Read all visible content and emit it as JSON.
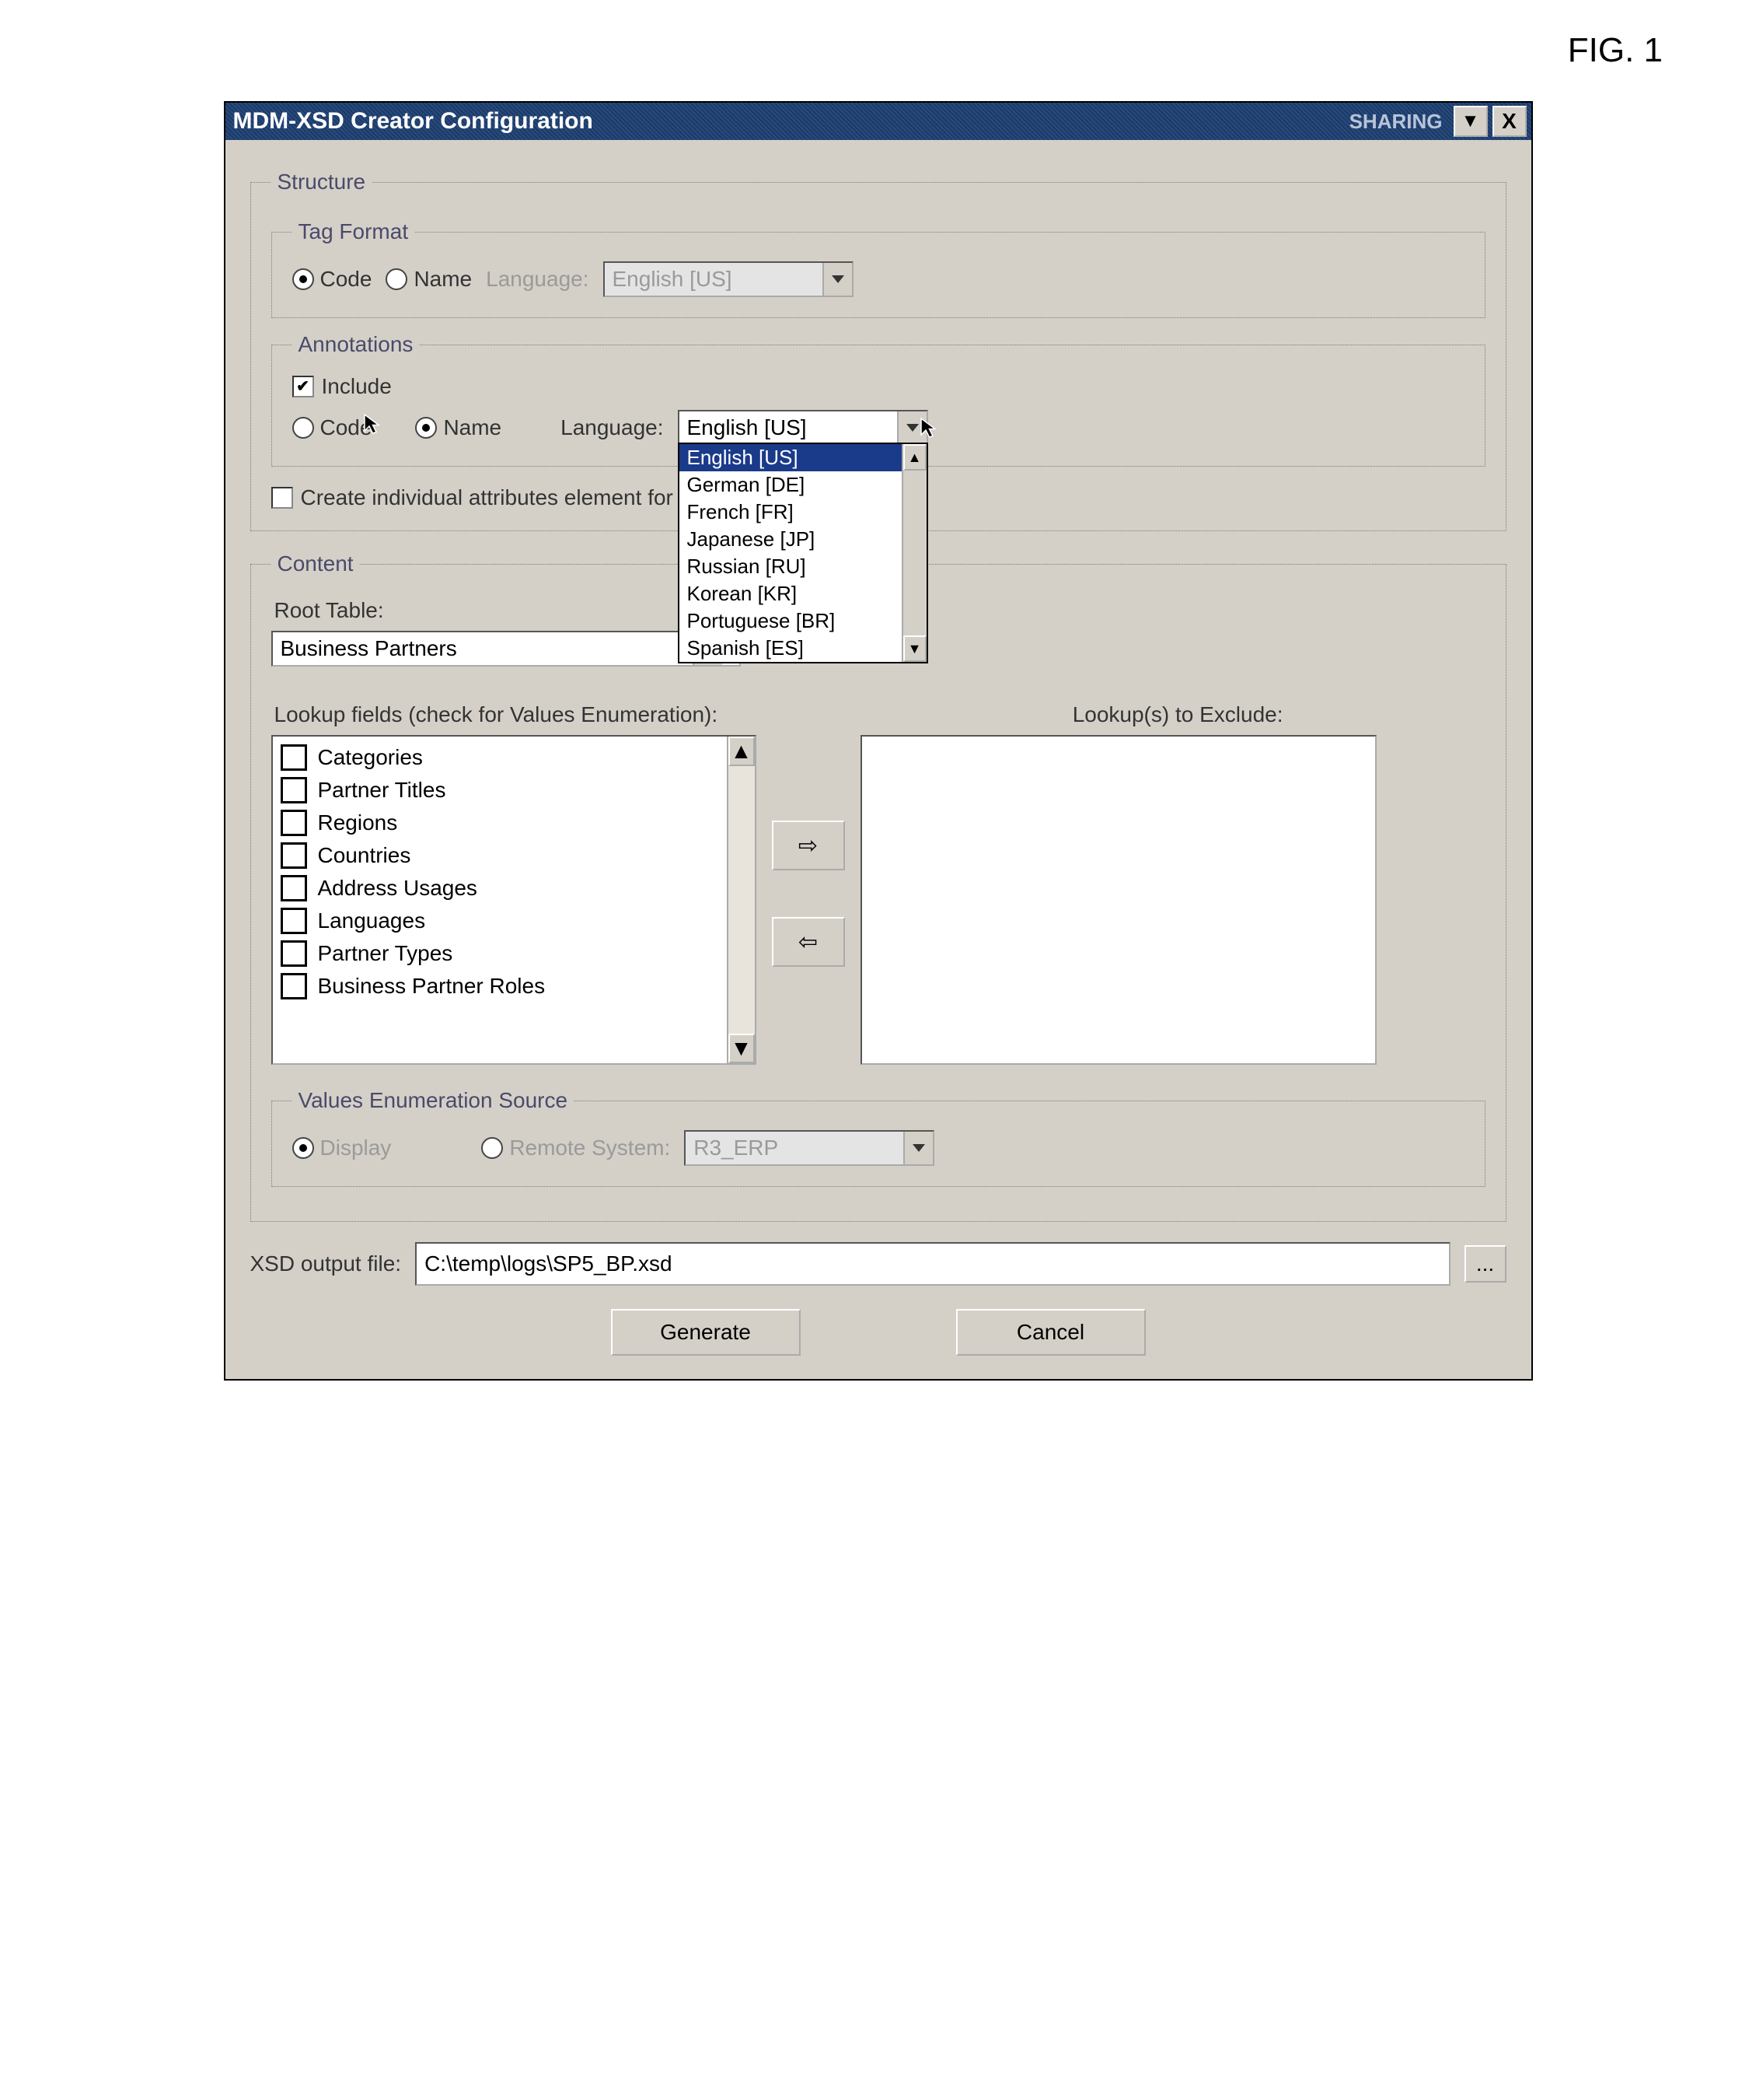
{
  "figure_label": "FIG. 1",
  "window": {
    "title": "MDM-XSD Creator Configuration",
    "right_label": "SHARING",
    "close": "X"
  },
  "structure": {
    "legend": "Structure",
    "tag_format": {
      "legend": "Tag Format",
      "code_label": "Code",
      "name_label": "Name",
      "language_label": "Language:",
      "language_value": "English [US]"
    },
    "annotations": {
      "legend": "Annotations",
      "include_label": "Include",
      "code_label": "Code",
      "name_label": "Name",
      "language_label": "Language:",
      "language_value": "English [US]",
      "options": [
        "English [US]",
        "German [DE]",
        "French [FR]",
        "Japanese [JP]",
        "Russian [RU]",
        "Korean [KR]",
        "Portuguese [BR]",
        "Spanish [ES]"
      ]
    },
    "individual_attr_label": "Create individual attributes element for ta"
  },
  "content": {
    "legend": "Content",
    "root_table_label": "Root Table:",
    "root_table_value": "Business Partners",
    "lookup_fields_label": "Lookup fields (check for Values Enumeration):",
    "lookup_exclude_label": "Lookup(s) to Exclude:",
    "lookup_items": [
      "Categories",
      "Partner Titles",
      "Regions",
      "Countries",
      "Address Usages",
      "Languages",
      "Partner Types",
      "Business Partner Roles"
    ],
    "values_enum": {
      "legend": "Values Enumeration Source",
      "display_label": "Display",
      "remote_label": "Remote System:",
      "remote_value": "R3_ERP"
    }
  },
  "output": {
    "label": "XSD output file:",
    "value": "C:\\temp\\logs\\SP5_BP.xsd",
    "browse": "..."
  },
  "buttons": {
    "generate": "Generate",
    "cancel": "Cancel"
  },
  "icons": {
    "arrow_right": "⇨",
    "arrow_left": "⇦",
    "up": "▲",
    "down": "▼"
  }
}
